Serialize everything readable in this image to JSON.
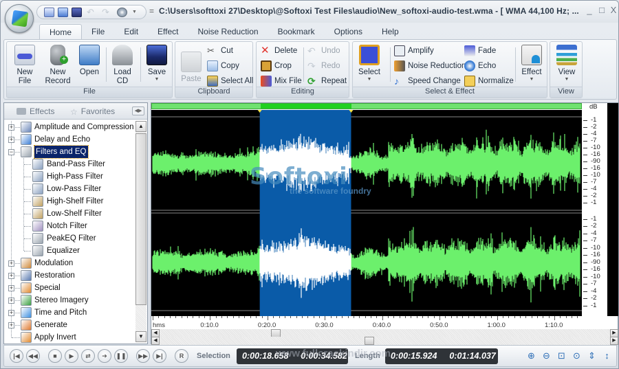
{
  "window": {
    "title": "C:\\Users\\softtoxi 27\\Desktop\\@Softoxi Test Files\\audio\\New_softoxi-audio-test.wma - [ WMA 44,100 Hz; ...",
    "title_separator": "=",
    "minimize": "_",
    "maximize": "□",
    "close": "X"
  },
  "quick_access": [
    "new-file-icon",
    "open-icon",
    "save-icon",
    "undo-icon",
    "redo-icon",
    "cd-icon",
    "dropdown-icon"
  ],
  "tabs": [
    {
      "label": "Home",
      "active": true
    },
    {
      "label": "File"
    },
    {
      "label": "Edit"
    },
    {
      "label": "Effect"
    },
    {
      "label": "Noise Reduction"
    },
    {
      "label": "Bookmark"
    },
    {
      "label": "Options"
    },
    {
      "label": "Help"
    }
  ],
  "ribbon": {
    "file_group": {
      "label": "File",
      "new_file": "New File",
      "new_file_l1": "New",
      "new_file_l2": "File",
      "new_record_l1": "New",
      "new_record_l2": "Record",
      "open": "Open",
      "load_cd_l1": "Load",
      "load_cd_l2": "CD",
      "save": "Save"
    },
    "clipboard_group": {
      "label": "Clipboard",
      "paste": "Paste",
      "cut": "Cut",
      "copy": "Copy",
      "select_all": "Select All"
    },
    "editing_group": {
      "label": "Editing",
      "delete": "Delete",
      "crop": "Crop",
      "mix_file": "Mix File",
      "undo": "Undo",
      "redo": "Redo",
      "repeat": "Repeat"
    },
    "select_effect_group": {
      "label": "Select & Effect",
      "select": "Select",
      "amplify": "Amplify",
      "noise_reduction": "Noise Reduction",
      "speed_change": "Speed Change",
      "fade": "Fade",
      "echo": "Echo",
      "normalize": "Normalize",
      "effect": "Effect"
    },
    "view_group": {
      "label": "View",
      "view": "View"
    }
  },
  "left_panel": {
    "tabs": {
      "effects": "Effects",
      "favorites": "Favorites"
    },
    "tree": [
      {
        "label": "Amplitude and Compression",
        "level": 0,
        "expander": "+"
      },
      {
        "label": "Delay and Echo",
        "level": 0,
        "expander": "+"
      },
      {
        "label": "Filters and EQ",
        "level": 0,
        "expander": "−",
        "selected": true
      },
      {
        "label": "Band-Pass Filter",
        "level": 1
      },
      {
        "label": "High-Pass Filter",
        "level": 1
      },
      {
        "label": "Low-Pass Filter",
        "level": 1
      },
      {
        "label": "High-Shelf Filter",
        "level": 1
      },
      {
        "label": "Low-Shelf Filter",
        "level": 1
      },
      {
        "label": "Notch Filter",
        "level": 1
      },
      {
        "label": "PeakEQ Filter",
        "level": 1
      },
      {
        "label": "Equalizer",
        "level": 1
      },
      {
        "label": "Modulation",
        "level": 0,
        "expander": "+"
      },
      {
        "label": "Restoration",
        "level": 0,
        "expander": "+"
      },
      {
        "label": "Special",
        "level": 0,
        "expander": "+"
      },
      {
        "label": "Stereo Imagery",
        "level": 0,
        "expander": "+"
      },
      {
        "label": "Time and Pitch",
        "level": 0,
        "expander": "+"
      },
      {
        "label": "Generate",
        "level": 0,
        "expander": "+"
      },
      {
        "label": "Apply Invert",
        "level": 0
      }
    ]
  },
  "waveform": {
    "db_header": "dB",
    "db_labels": [
      "-1",
      "-2",
      "-4",
      "-7",
      "-10",
      "-16",
      "-90",
      "-16",
      "-10",
      "-7",
      "-4",
      "-2",
      "-1"
    ],
    "time_unit": "hms",
    "time_labels": [
      "0:10.0",
      "0:20.0",
      "0:30.0",
      "0:40.0",
      "0:50.0",
      "1:00.0",
      "1:10.0"
    ],
    "selection_start_s": 18.658,
    "selection_end_s": 34.582,
    "total_length_s": 74.037,
    "colors": {
      "wave": "#6cf06c",
      "selected_wave": "#ffffff",
      "selection_bg": "#0a5ba8",
      "background": "#000000"
    }
  },
  "transport": {
    "buttons": [
      "go-start",
      "rewind",
      "stop",
      "play",
      "loop",
      "play-selection",
      "pause",
      "fast-forward",
      "go-end",
      "record"
    ],
    "record_label": "R",
    "selection_label": "Selection",
    "selection_start": "0:00:18.658",
    "selection_end": "0:00:34.582",
    "length_label": "Length",
    "selection_length": "0:00:15.924",
    "total_length": "0:01:14.037",
    "zoom_buttons": [
      "zoom-in-icon",
      "zoom-out-icon",
      "zoom-selection-icon",
      "zoom-full-icon",
      "zoom-in-vertical-icon",
      "zoom-out-vertical-icon"
    ]
  },
  "watermarks": {
    "logo_text": "Softoxi",
    "logo_sub": "the software foundry",
    "url": "www.fullcrackindir.com"
  }
}
